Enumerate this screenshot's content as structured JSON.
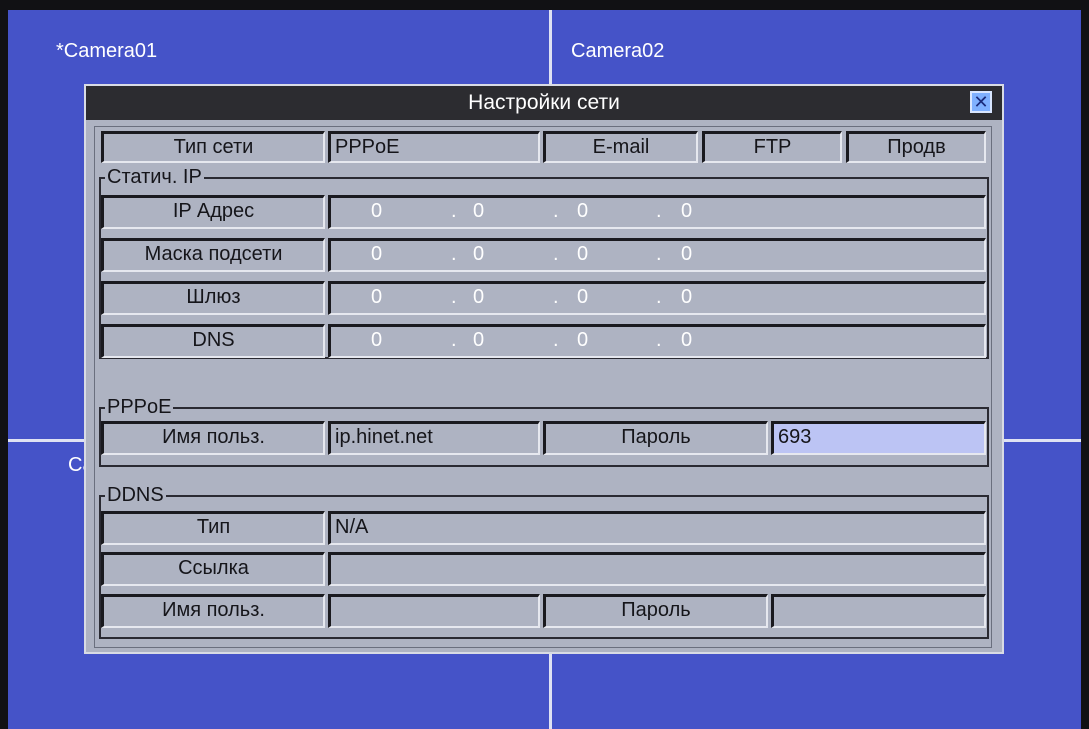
{
  "cameras": {
    "cam1": "*Camera01",
    "cam2": "Camera02",
    "cam3_partial": "Ca"
  },
  "dialog": {
    "title": "Настройки сети",
    "close_glyph": "✕"
  },
  "tabs": {
    "network_type_label": "Тип сети",
    "network_type_value": "PPPoE",
    "email": "E-mail",
    "ftp": "FTP",
    "advanced": "Продв"
  },
  "static_ip": {
    "title": "Статич. IP",
    "rows": [
      {
        "label": "IP Адрес",
        "octets": [
          "0",
          "0",
          "0",
          "0"
        ]
      },
      {
        "label": "Маска подсети",
        "octets": [
          "0",
          "0",
          "0",
          "0"
        ]
      },
      {
        "label": "Шлюз",
        "octets": [
          "0",
          "0",
          "0",
          "0"
        ]
      },
      {
        "label": "DNS",
        "octets": [
          "0",
          "0",
          "0",
          "0"
        ]
      }
    ],
    "dot": "."
  },
  "pppoe": {
    "title": "PPPoE",
    "user_label": "Имя польз.",
    "user_value": "ip.hinet.net",
    "password_label": "Пароль",
    "password_value": "693"
  },
  "ddns": {
    "title": "DDNS",
    "type_label": "Тип",
    "type_value": "N/A",
    "link_label": "Ссылка",
    "link_value": "",
    "user_label": "Имя польз.",
    "user_value": "",
    "password_label": "Пароль",
    "password_value": ""
  }
}
